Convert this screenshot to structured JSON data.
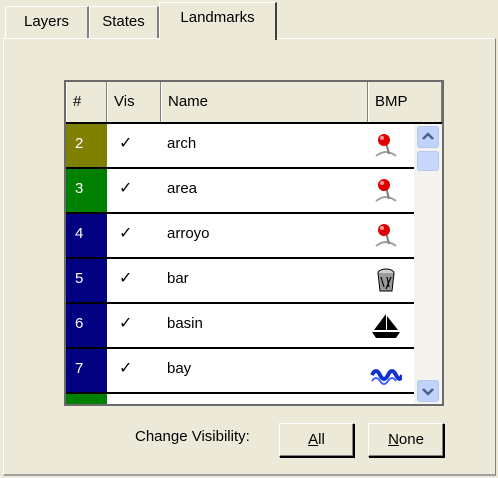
{
  "tabs": [
    {
      "label": "Layers"
    },
    {
      "label": "States"
    },
    {
      "label": "Landmarks"
    }
  ],
  "table": {
    "columns": [
      "#",
      "Vis",
      "Name",
      "BMP"
    ],
    "rows": [
      {
        "num": "2",
        "vis": "✓",
        "name": "arch",
        "color": "#808000",
        "bmp": "pushpin-icon"
      },
      {
        "num": "3",
        "vis": "✓",
        "name": "area",
        "color": "#008000",
        "bmp": "pushpin-icon"
      },
      {
        "num": "4",
        "vis": "✓",
        "name": "arroyo",
        "color": "#000080",
        "bmp": "pushpin-icon"
      },
      {
        "num": "5",
        "vis": "✓",
        "name": "bar",
        "color": "#000080",
        "bmp": "bar-glass-icon"
      },
      {
        "num": "6",
        "vis": "✓",
        "name": "basin",
        "color": "#000080",
        "bmp": "sailboat-icon"
      },
      {
        "num": "7",
        "vis": "✓",
        "name": "bay",
        "color": "#000080",
        "bmp": "wave-icon"
      },
      {
        "num": "",
        "vis": "",
        "name": "",
        "color": "#008000",
        "bmp": "pushpin-icon"
      }
    ]
  },
  "footer": {
    "change_visibility_label": "Change Visibility:",
    "all_button": {
      "prefix": "",
      "accel": "A",
      "rest": "ll"
    },
    "none_button": {
      "prefix": "",
      "accel": "N",
      "rest": "one"
    }
  }
}
